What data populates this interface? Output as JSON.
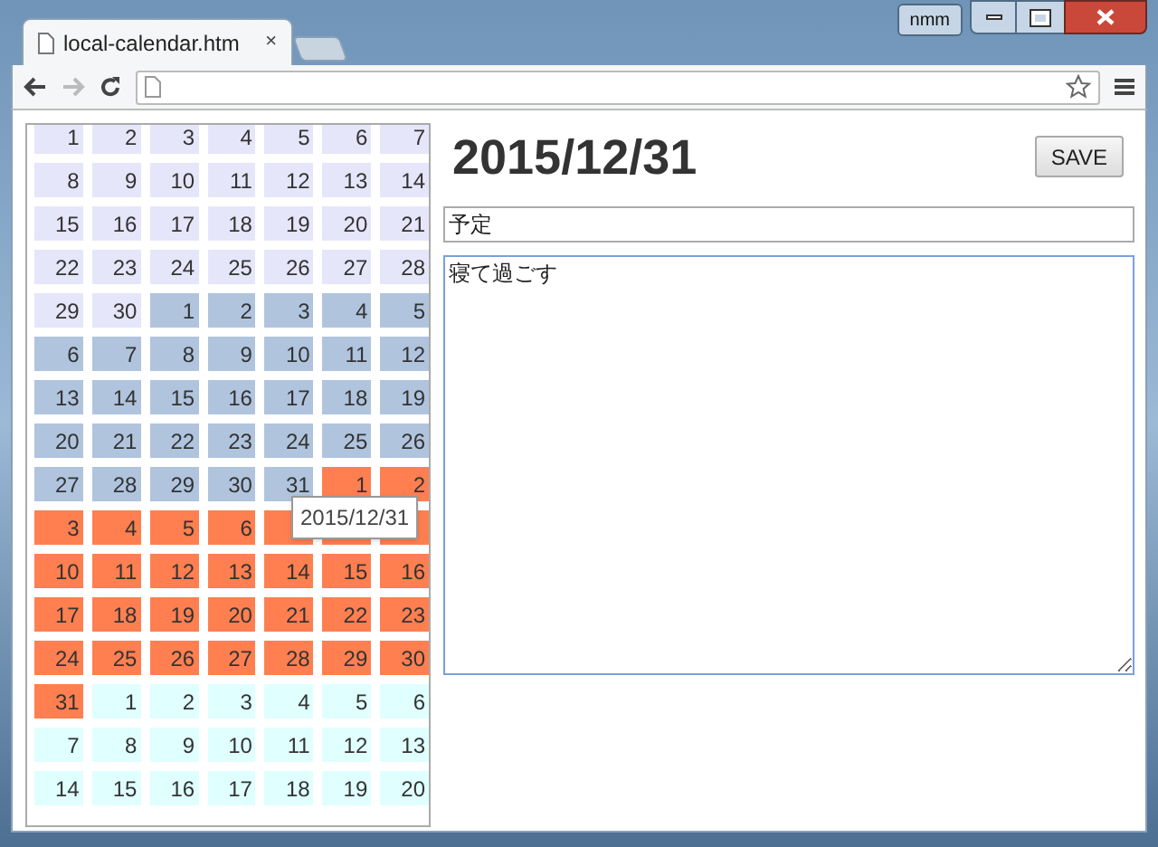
{
  "browser": {
    "tab_title": "local-calendar.htm",
    "tab_close": "×",
    "profile": "nmm"
  },
  "calendar": {
    "weeks": [
      [
        {
          "day": "1",
          "color": "#e6e6fa"
        },
        {
          "day": "2",
          "color": "#e6e6fa"
        },
        {
          "day": "3",
          "color": "#e6e6fa"
        },
        {
          "day": "4",
          "color": "#e6e6fa"
        },
        {
          "day": "5",
          "color": "#e6e6fa"
        },
        {
          "day": "6",
          "color": "#e6e6fa"
        },
        {
          "day": "7",
          "color": "#e6e6fa"
        }
      ],
      [
        {
          "day": "8",
          "color": "#e6e6fa"
        },
        {
          "day": "9",
          "color": "#e6e6fa"
        },
        {
          "day": "10",
          "color": "#e6e6fa"
        },
        {
          "day": "11",
          "color": "#e6e6fa"
        },
        {
          "day": "12",
          "color": "#e6e6fa"
        },
        {
          "day": "13",
          "color": "#e6e6fa"
        },
        {
          "day": "14",
          "color": "#e6e6fa"
        }
      ],
      [
        {
          "day": "15",
          "color": "#e6e6fa"
        },
        {
          "day": "16",
          "color": "#e6e6fa"
        },
        {
          "day": "17",
          "color": "#e6e6fa"
        },
        {
          "day": "18",
          "color": "#e6e6fa"
        },
        {
          "day": "19",
          "color": "#e6e6fa"
        },
        {
          "day": "20",
          "color": "#e6e6fa"
        },
        {
          "day": "21",
          "color": "#e6e6fa"
        }
      ],
      [
        {
          "day": "22",
          "color": "#e6e6fa"
        },
        {
          "day": "23",
          "color": "#e6e6fa"
        },
        {
          "day": "24",
          "color": "#e6e6fa"
        },
        {
          "day": "25",
          "color": "#e6e6fa"
        },
        {
          "day": "26",
          "color": "#e6e6fa"
        },
        {
          "day": "27",
          "color": "#e6e6fa"
        },
        {
          "day": "28",
          "color": "#e6e6fa"
        }
      ],
      [
        {
          "day": "29",
          "color": "#e6e6fa"
        },
        {
          "day": "30",
          "color": "#e6e6fa"
        },
        {
          "day": "1",
          "color": "#b0c4de"
        },
        {
          "day": "2",
          "color": "#b0c4de"
        },
        {
          "day": "3",
          "color": "#b0c4de"
        },
        {
          "day": "4",
          "color": "#b0c4de"
        },
        {
          "day": "5",
          "color": "#b0c4de"
        }
      ],
      [
        {
          "day": "6",
          "color": "#b0c4de"
        },
        {
          "day": "7",
          "color": "#b0c4de"
        },
        {
          "day": "8",
          "color": "#b0c4de"
        },
        {
          "day": "9",
          "color": "#b0c4de"
        },
        {
          "day": "10",
          "color": "#b0c4de"
        },
        {
          "day": "11",
          "color": "#b0c4de"
        },
        {
          "day": "12",
          "color": "#b0c4de"
        }
      ],
      [
        {
          "day": "13",
          "color": "#b0c4de"
        },
        {
          "day": "14",
          "color": "#b0c4de"
        },
        {
          "day": "15",
          "color": "#b0c4de"
        },
        {
          "day": "16",
          "color": "#b0c4de"
        },
        {
          "day": "17",
          "color": "#b0c4de"
        },
        {
          "day": "18",
          "color": "#b0c4de"
        },
        {
          "day": "19",
          "color": "#b0c4de"
        }
      ],
      [
        {
          "day": "20",
          "color": "#b0c4de"
        },
        {
          "day": "21",
          "color": "#b0c4de"
        },
        {
          "day": "22",
          "color": "#b0c4de"
        },
        {
          "day": "23",
          "color": "#b0c4de"
        },
        {
          "day": "24",
          "color": "#b0c4de"
        },
        {
          "day": "25",
          "color": "#b0c4de"
        },
        {
          "day": "26",
          "color": "#b0c4de"
        }
      ],
      [
        {
          "day": "27",
          "color": "#b0c4de"
        },
        {
          "day": "28",
          "color": "#b0c4de"
        },
        {
          "day": "29",
          "color": "#b0c4de"
        },
        {
          "day": "30",
          "color": "#b0c4de"
        },
        {
          "day": "31",
          "color": "#b0c4de"
        },
        {
          "day": "1",
          "color": "#ff7f50"
        },
        {
          "day": "2",
          "color": "#ff7f50"
        }
      ],
      [
        {
          "day": "3",
          "color": "#ff7f50"
        },
        {
          "day": "4",
          "color": "#ff7f50"
        },
        {
          "day": "5",
          "color": "#ff7f50"
        },
        {
          "day": "6",
          "color": "#ff7f50"
        },
        {
          "color": "#ff7f50"
        },
        {
          "color": "#ff7f50"
        },
        {
          "color": "#ff7f50"
        }
      ],
      [
        {
          "day": "10",
          "color": "#ff7f50"
        },
        {
          "day": "11",
          "color": "#ff7f50"
        },
        {
          "day": "12",
          "color": "#ff7f50"
        },
        {
          "day": "13",
          "color": "#ff7f50"
        },
        {
          "day": "14",
          "color": "#ff7f50"
        },
        {
          "day": "15",
          "color": "#ff7f50"
        },
        {
          "day": "16",
          "color": "#ff7f50"
        }
      ],
      [
        {
          "day": "17",
          "color": "#ff7f50"
        },
        {
          "day": "18",
          "color": "#ff7f50"
        },
        {
          "day": "19",
          "color": "#ff7f50"
        },
        {
          "day": "20",
          "color": "#ff7f50"
        },
        {
          "day": "21",
          "color": "#ff7f50"
        },
        {
          "day": "22",
          "color": "#ff7f50"
        },
        {
          "day": "23",
          "color": "#ff7f50"
        }
      ],
      [
        {
          "day": "24",
          "color": "#ff7f50"
        },
        {
          "day": "25",
          "color": "#ff7f50"
        },
        {
          "day": "26",
          "color": "#ff7f50"
        },
        {
          "day": "27",
          "color": "#ff7f50"
        },
        {
          "day": "28",
          "color": "#ff7f50"
        },
        {
          "day": "29",
          "color": "#ff7f50"
        },
        {
          "day": "30",
          "color": "#ff7f50"
        }
      ],
      [
        {
          "day": "31",
          "color": "#ff7f50"
        },
        {
          "day": "1",
          "color": "#e0ffff"
        },
        {
          "day": "2",
          "color": "#e0ffff"
        },
        {
          "day": "3",
          "color": "#e0ffff"
        },
        {
          "day": "4",
          "color": "#e0ffff"
        },
        {
          "day": "5",
          "color": "#e0ffff"
        },
        {
          "day": "6",
          "color": "#e0ffff"
        }
      ],
      [
        {
          "day": "7",
          "color": "#e0ffff"
        },
        {
          "day": "8",
          "color": "#e0ffff"
        },
        {
          "day": "9",
          "color": "#e0ffff"
        },
        {
          "day": "10",
          "color": "#e0ffff"
        },
        {
          "day": "11",
          "color": "#e0ffff"
        },
        {
          "day": "12",
          "color": "#e0ffff"
        },
        {
          "day": "13",
          "color": "#e0ffff"
        }
      ],
      [
        {
          "day": "14",
          "color": "#e0ffff"
        },
        {
          "day": "15",
          "color": "#e0ffff"
        },
        {
          "day": "16",
          "color": "#e0ffff"
        },
        {
          "day": "17",
          "color": "#e0ffff"
        },
        {
          "day": "18",
          "color": "#e0ffff"
        },
        {
          "day": "19",
          "color": "#e0ffff"
        },
        {
          "day": "20",
          "color": "#e0ffff"
        }
      ]
    ]
  },
  "tooltip": "2015/12/31",
  "editor": {
    "date": "2015/12/31",
    "save": "SAVE",
    "title_value": "予定",
    "body_value": "寝て過ごす"
  }
}
